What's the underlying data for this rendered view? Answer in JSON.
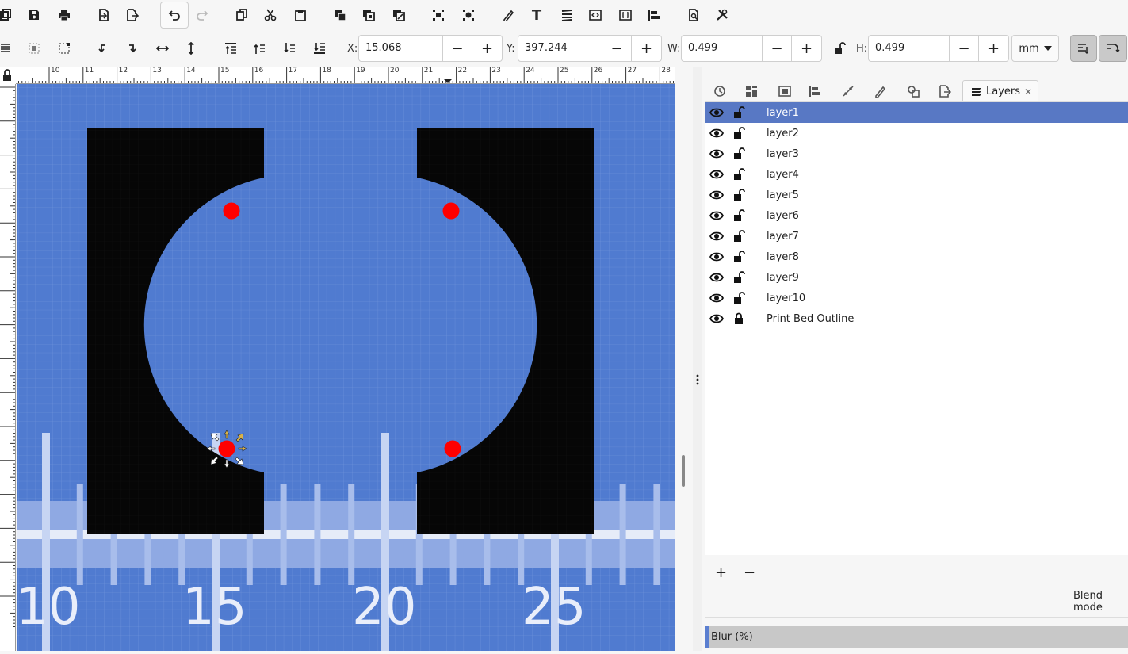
{
  "toolbar": {
    "x_label": "X:",
    "x_value": "15.068",
    "y_label": "Y:",
    "y_value": "397.244",
    "w_label": "W:",
    "w_value": "0.499",
    "h_label": "H:",
    "h_value": "0.499",
    "minus": "−",
    "plus": "+",
    "unit": "mm"
  },
  "ruler": {
    "h_numbers": [
      "10",
      "11",
      "12",
      "13",
      "14",
      "15",
      "16",
      "17",
      "18",
      "19",
      "20",
      "21",
      "22",
      "23",
      "24",
      "25",
      "26",
      "27",
      "28"
    ]
  },
  "canvas": {
    "scale_numbers": [
      "10",
      "15",
      "20",
      "25"
    ]
  },
  "panel": {
    "active_tab": "Layers",
    "close_glyph": "✕",
    "layers": [
      {
        "name": "layer1",
        "locked": false,
        "selected": true
      },
      {
        "name": "layer2",
        "locked": false,
        "selected": false
      },
      {
        "name": "layer3",
        "locked": false,
        "selected": false
      },
      {
        "name": "layer4",
        "locked": false,
        "selected": false
      },
      {
        "name": "layer5",
        "locked": false,
        "selected": false
      },
      {
        "name": "layer6",
        "locked": false,
        "selected": false
      },
      {
        "name": "layer7",
        "locked": false,
        "selected": false
      },
      {
        "name": "layer8",
        "locked": false,
        "selected": false
      },
      {
        "name": "layer9",
        "locked": false,
        "selected": false
      },
      {
        "name": "layer10",
        "locked": false,
        "selected": false
      },
      {
        "name": "Print Bed Outline",
        "locked": true,
        "selected": false
      }
    ],
    "add_label": "+",
    "remove_label": "−",
    "blend_label": "Blend mode",
    "blur_label": "Blur (%)"
  },
  "colors": {
    "canvas_bg": "#507bd0",
    "selection": "#5878c4",
    "node": "#ff0000"
  }
}
